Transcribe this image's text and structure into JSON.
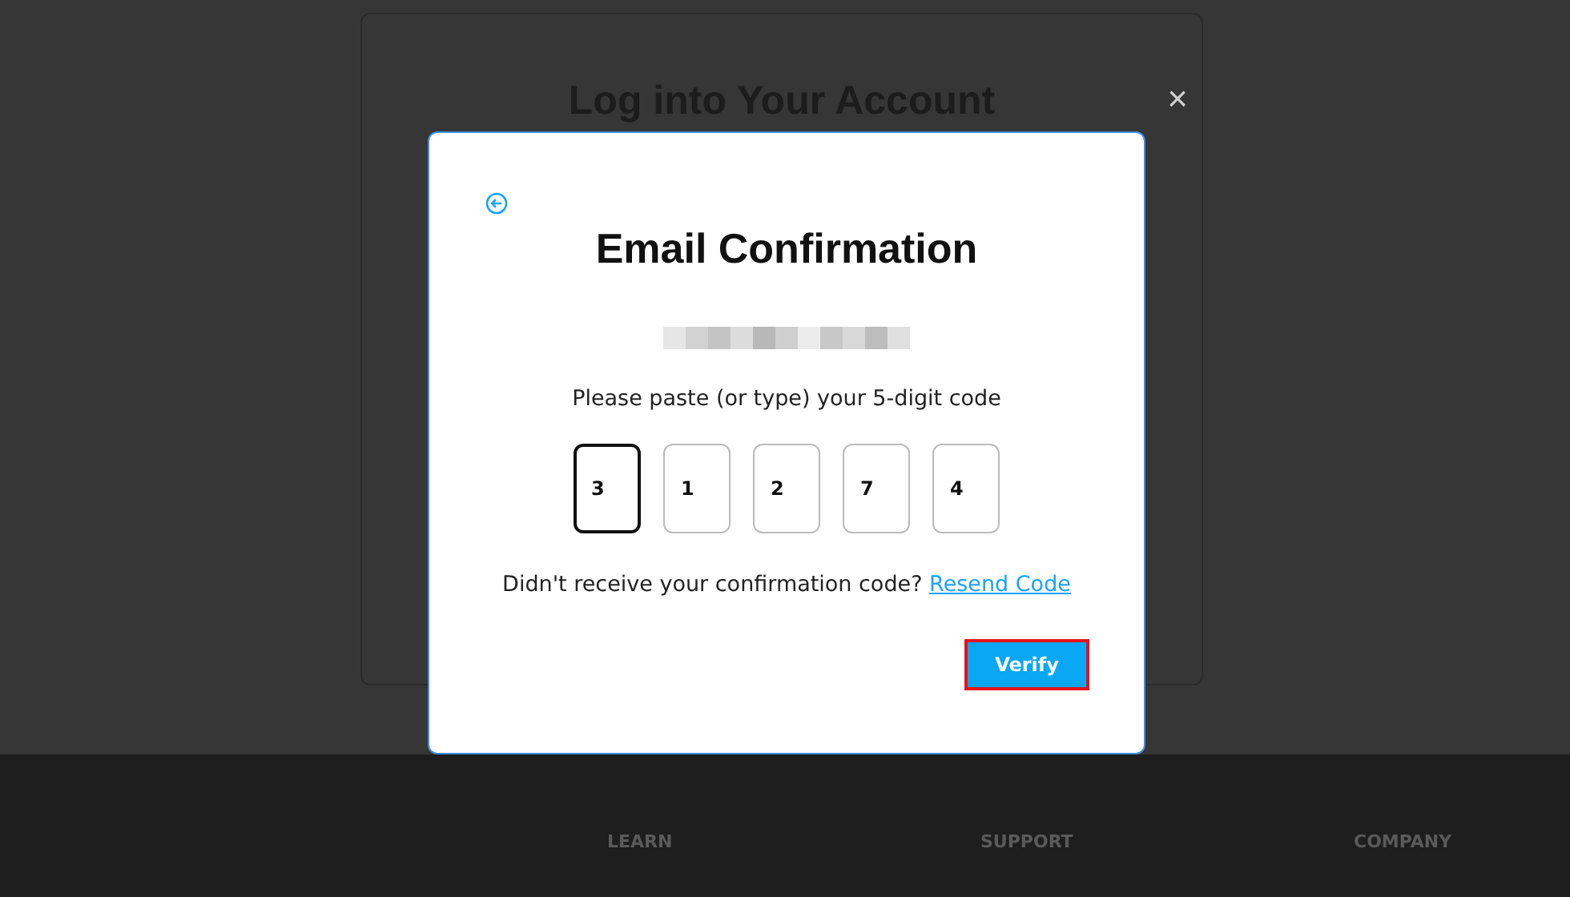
{
  "background_card": {
    "title": "Log into Your Account"
  },
  "footer": {
    "headings": [
      "LEARN",
      "SUPPORT",
      "COMPANY"
    ]
  },
  "overlay": {
    "close": "×"
  },
  "dialog": {
    "title": "Email Confirmation",
    "email": {
      "kind": "redacted"
    },
    "instruction": "Please paste (or type) your 5-digit code",
    "code_boxes": [
      {
        "value": "3",
        "selected": true
      },
      {
        "value": "1",
        "selected": false
      },
      {
        "value": "2",
        "selected": false
      },
      {
        "value": "7",
        "selected": false
      },
      {
        "value": "4",
        "selected": false
      }
    ],
    "resend_prompt": "Didn't receive your confirmation code?",
    "resend_link": "Resend Code",
    "verify_button": {
      "label": "Verify",
      "highlighted": true
    }
  }
}
